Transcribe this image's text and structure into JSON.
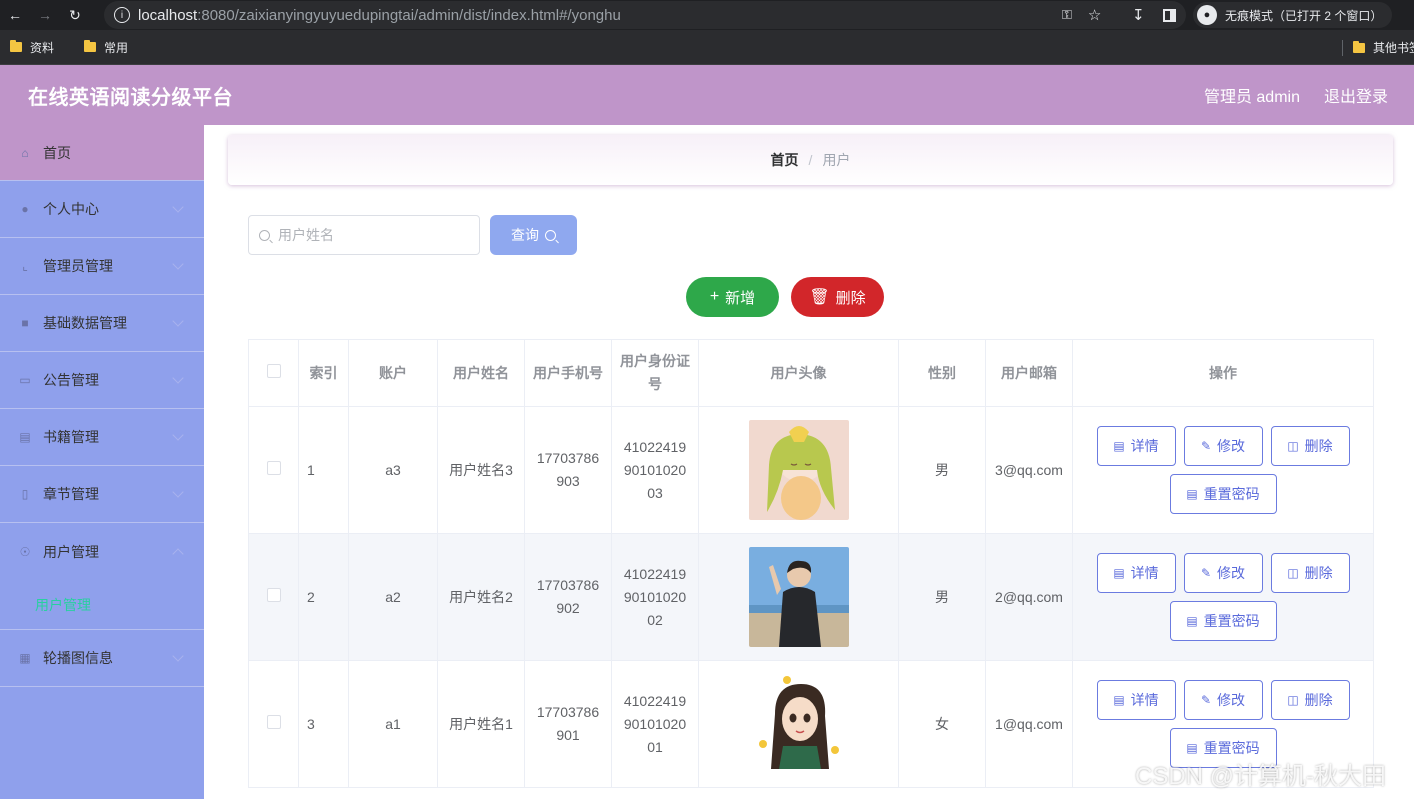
{
  "browser": {
    "url_host": "localhost",
    "url_rest": ":8080/zaixianyingyuyuedupingtai/admin/dist/index.html#/yonghu",
    "incognito_label": "无痕模式（已打开 2 个窗口）",
    "bookmarks": [
      "资料",
      "常用"
    ],
    "bookmark_right": "其他书签"
  },
  "app": {
    "title": "在线英语阅读分级平台",
    "user_label": "管理员 admin",
    "logout_label": "退出登录"
  },
  "sidebar": {
    "items": [
      {
        "label": "首页",
        "icon": "home-icon"
      },
      {
        "label": "个人中心",
        "icon": "user-icon"
      },
      {
        "label": "管理员管理",
        "icon": "crop-icon"
      },
      {
        "label": "基础数据管理",
        "icon": "pin-icon"
      },
      {
        "label": "公告管理",
        "icon": "monitor-icon"
      },
      {
        "label": "书籍管理",
        "icon": "chart-icon"
      },
      {
        "label": "章节管理",
        "icon": "message-icon"
      },
      {
        "label": "用户管理",
        "icon": "globe-icon"
      },
      {
        "label": "轮播图信息",
        "icon": "album-icon"
      }
    ],
    "submenu_active": "用户管理"
  },
  "breadcrumb": {
    "home": "首页",
    "separator": "/",
    "current": "用户"
  },
  "search": {
    "placeholder": "用户姓名",
    "query_label": "查询"
  },
  "actions": {
    "add_label": "新增",
    "delete_label": "删除"
  },
  "table": {
    "headers": [
      "索引",
      "账户",
      "用户姓名",
      "用户手机号",
      "用户身份证号",
      "用户头像",
      "性别",
      "用户邮箱",
      "操作"
    ],
    "rows": [
      {
        "index": "1",
        "account": "a3",
        "name": "用户姓名3",
        "phone": "17703786903",
        "id_card": "410224199010102003",
        "gender": "男",
        "email": "3@qq.com"
      },
      {
        "index": "2",
        "account": "a2",
        "name": "用户姓名2",
        "phone": "17703786902",
        "id_card": "410224199010102002",
        "gender": "男",
        "email": "2@qq.com"
      },
      {
        "index": "3",
        "account": "a1",
        "name": "用户姓名1",
        "phone": "17703786901",
        "id_card": "410224199010102001",
        "gender": "女",
        "email": "1@qq.com"
      }
    ],
    "row_buttons": {
      "detail": "详情",
      "edit": "修改",
      "delete": "删除",
      "reset": "重置密码"
    }
  },
  "watermark": "CSDN @计算机-秋大田",
  "colors": {
    "header": "#bf95c9",
    "sidebar": "#8fa0ec",
    "add": "#2ea84a",
    "delete": "#d2262a",
    "query": "#8fa8ef",
    "submenu_active": "#28d0a0"
  }
}
